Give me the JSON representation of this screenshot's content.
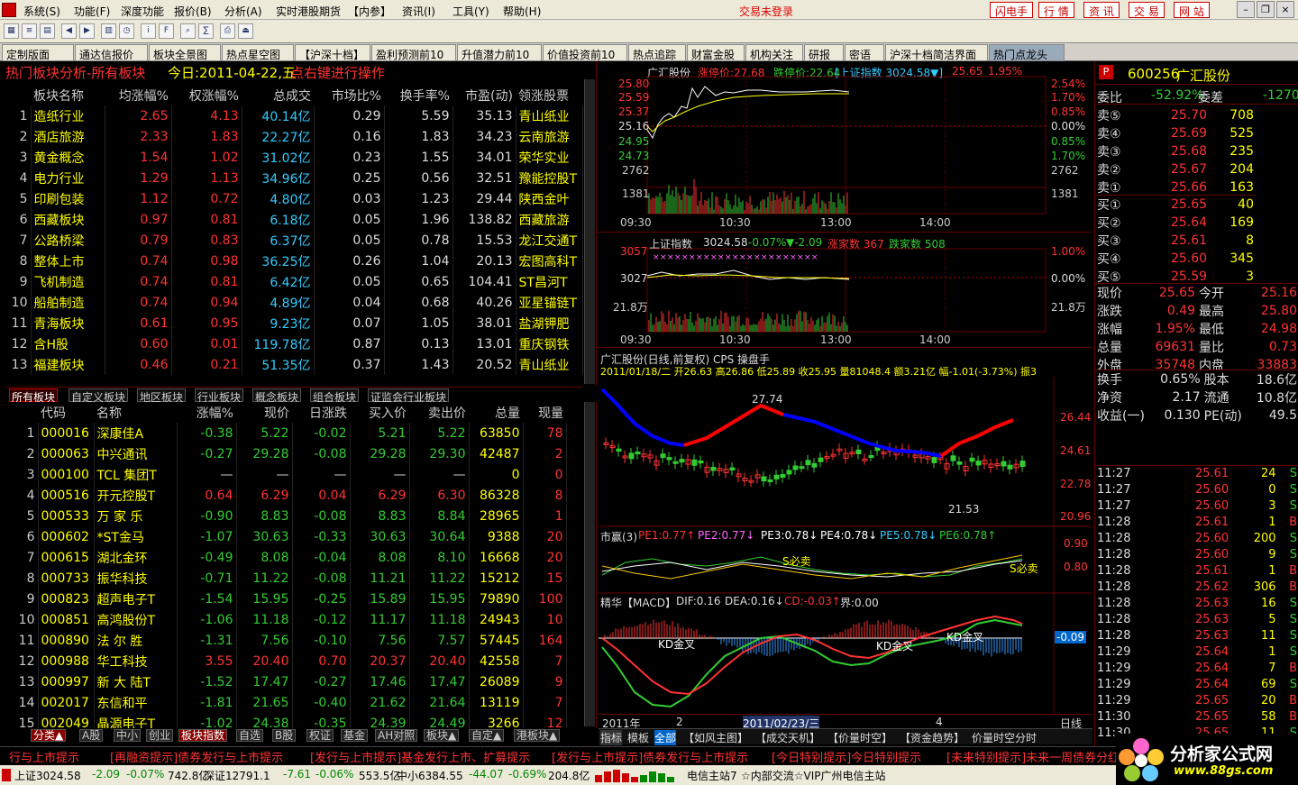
{
  "menu": [
    "系统(S)",
    "功能(F)",
    "深度功能",
    "报价(B)",
    "分析(A)",
    "实时港股期货",
    "【内参】",
    "资讯(I)",
    "工具(Y)",
    "帮助(H)"
  ],
  "menu_center": "交易未登录",
  "menu_right": [
    "闪电手",
    "行 情",
    "资 讯",
    "交 易",
    "网 站"
  ],
  "tabs": [
    "定制版面",
    "通达信报价",
    "板块全景图",
    "热点星空图",
    "【沪深十档】",
    "盈利预测前10",
    "升值潜力前10",
    "价值投资前10",
    "热点追踪",
    "财富金股",
    "机构关注",
    "研报",
    "密语",
    "沪深十档简洁界面",
    "热门点龙头"
  ],
  "sector": {
    "title": "热门板块分析-所有板块",
    "date": "今日:2011-04-22,五",
    "hint": "点右键进行操作",
    "headers": [
      "板块名称",
      "均涨幅%",
      "权涨幅%",
      "总成交",
      "市场比%",
      "换手率%",
      "市盈(动)",
      "领涨股票"
    ],
    "rows": [
      [
        "1",
        "造纸行业",
        "2.65",
        "4.13",
        "40.14亿",
        "0.29",
        "5.59",
        "35.13",
        "青山纸业"
      ],
      [
        "2",
        "酒店旅游",
        "2.33",
        "1.83",
        "22.27亿",
        "0.16",
        "1.83",
        "34.23",
        "云南旅游"
      ],
      [
        "3",
        "黄金概念",
        "1.54",
        "1.02",
        "31.02亿",
        "0.23",
        "1.55",
        "34.01",
        "荣华实业"
      ],
      [
        "4",
        "电力行业",
        "1.29",
        "1.13",
        "34.96亿",
        "0.25",
        "0.56",
        "32.51",
        "豫能控股T"
      ],
      [
        "5",
        "印刷包装",
        "1.12",
        "0.72",
        "4.80亿",
        "0.03",
        "1.23",
        "29.44",
        "陕西金叶"
      ],
      [
        "6",
        "西藏板块",
        "0.97",
        "0.81",
        "6.18亿",
        "0.05",
        "1.96",
        "138.82",
        "西藏旅游"
      ],
      [
        "7",
        "公路桥梁",
        "0.79",
        "0.83",
        "6.37亿",
        "0.05",
        "0.78",
        "15.53",
        "龙江交通T"
      ],
      [
        "8",
        "整体上市",
        "0.74",
        "0.98",
        "36.25亿",
        "0.26",
        "1.04",
        "20.13",
        "宏图高科T"
      ],
      [
        "9",
        "飞机制造",
        "0.74",
        "0.81",
        "6.42亿",
        "0.05",
        "0.65",
        "104.41",
        "ST昌河T"
      ],
      [
        "10",
        "船舶制造",
        "0.74",
        "0.94",
        "4.89亿",
        "0.04",
        "0.68",
        "40.26",
        "亚星锚链T"
      ],
      [
        "11",
        "青海板块",
        "0.61",
        "0.95",
        "9.23亿",
        "0.07",
        "1.05",
        "38.01",
        "盐湖钾肥"
      ],
      [
        "12",
        "含H股",
        "0.60",
        "0.01",
        "119.78亿",
        "0.87",
        "0.13",
        "13.01",
        "重庆钢铁"
      ],
      [
        "13",
        "福建板块",
        "0.46",
        "0.21",
        "51.35亿",
        "0.37",
        "1.43",
        "20.52",
        "青山纸业"
      ]
    ]
  },
  "subtabs": [
    "所有板块",
    "自定义板块",
    "地区板块",
    "行业板块",
    "概念板块",
    "组合板块",
    "证监会行业板块"
  ],
  "stocks": {
    "headers": [
      "代码",
      "名称",
      "涨幅%",
      "现价",
      "日涨跌",
      "买入价",
      "卖出价",
      "总量",
      "现量"
    ],
    "rows": [
      [
        "1",
        "000016",
        "深康佳A",
        "-0.38",
        "5.22",
        "-0.02",
        "5.21",
        "5.22",
        "63850",
        "78"
      ],
      [
        "2",
        "000063",
        "中兴通讯",
        "-0.27",
        "29.28",
        "-0.08",
        "29.28",
        "29.30",
        "42487",
        "2"
      ],
      [
        "3",
        "000100",
        "TCL 集团T",
        "—",
        "—",
        "—",
        "—",
        "—",
        "0",
        "0"
      ],
      [
        "4",
        "000516",
        "开元控股T",
        "0.64",
        "6.29",
        "0.04",
        "6.29",
        "6.30",
        "86328",
        "8"
      ],
      [
        "5",
        "000533",
        "万 家 乐",
        "-0.90",
        "8.83",
        "-0.08",
        "8.83",
        "8.84",
        "28965",
        "1"
      ],
      [
        "6",
        "000602",
        "*ST金马",
        "-1.07",
        "30.63",
        "-0.33",
        "30.63",
        "30.64",
        "9388",
        "20"
      ],
      [
        "7",
        "000615",
        "湖北金环",
        "-0.49",
        "8.08",
        "-0.04",
        "8.08",
        "8.10",
        "16668",
        "20"
      ],
      [
        "8",
        "000733",
        "振华科技",
        "-0.71",
        "11.22",
        "-0.08",
        "11.21",
        "11.22",
        "15212",
        "15"
      ],
      [
        "9",
        "000823",
        "超声电子T",
        "-1.54",
        "15.95",
        "-0.25",
        "15.89",
        "15.95",
        "79890",
        "100"
      ],
      [
        "10",
        "000851",
        "高鸿股份T",
        "-1.06",
        "11.18",
        "-0.12",
        "11.17",
        "11.18",
        "24943",
        "10"
      ],
      [
        "11",
        "000890",
        "法 尔 胜",
        "-1.31",
        "7.56",
        "-0.10",
        "7.56",
        "7.57",
        "57445",
        "164"
      ],
      [
        "12",
        "000988",
        "华工科技",
        "3.55",
        "20.40",
        "0.70",
        "20.37",
        "20.40",
        "42558",
        "7"
      ],
      [
        "13",
        "000997",
        "新 大 陆T",
        "-1.52",
        "17.47",
        "-0.27",
        "17.46",
        "17.47",
        "26089",
        "9"
      ],
      [
        "14",
        "002017",
        "东信和平",
        "-1.81",
        "21.65",
        "-0.40",
        "21.62",
        "21.64",
        "13119",
        "7"
      ],
      [
        "15",
        "002049",
        "晶源电子T",
        "-1.02",
        "24.38",
        "-0.35",
        "24.39",
        "24.49",
        "3266",
        "12"
      ]
    ]
  },
  "bottom_tabs": [
    "分类▲",
    "A股",
    "中小",
    "创业",
    "板块指数",
    "自选",
    "B股",
    "权证",
    "基金",
    "AH对照",
    "板块▲",
    "自定▲",
    "港板块▲"
  ],
  "intraday1": {
    "name": "广汇股份",
    "zt": "涨停价:27.68",
    "dt": "跌停价:22.64",
    "idx": "[上证指数 3024.58▼]",
    "price": "25.65",
    "pct": "1.95%",
    "left_ticks": [
      "25.80",
      "25.59",
      "25.37",
      "25.16",
      "24.95",
      "24.73",
      "2762",
      "1381"
    ],
    "right_ticks": [
      "2.54%",
      "1.70%",
      "0.85%",
      "0.00%",
      "0.85%",
      "1.70%",
      "2762",
      "1381"
    ],
    "times": [
      "09:30",
      "10:30",
      "13:00",
      "14:00"
    ]
  },
  "intraday2": {
    "name": "上证指数",
    "val": "3024.58",
    "pct": "-0.07%",
    "chg": "▼-2.09",
    "up": "涨家数 367",
    "down": "跌家数 508",
    "left_ticks": [
      "3057",
      "3027",
      "21.8万"
    ],
    "right_ticks": [
      "1.00%",
      "0.00%",
      "21.8万"
    ],
    "times": [
      "09:30",
      "10:30",
      "13:00",
      "14:00"
    ]
  },
  "kline": {
    "title": "广汇股份(日线,前复权) CPS 操盘手",
    "info": "2011/01/18/二 开26.63 高26.86 低25.89 收25.95 量81048.4 额3.21亿 幅-1.01(-3.73%) 振3",
    "ticks": [
      "26.44",
      "24.61",
      "22.78",
      "20.96"
    ],
    "high_label": "27.74",
    "low_label": "21.53",
    "ind1": [
      "市赢(3)",
      "PE1:0.77↑",
      "PE2:0.77↓",
      "PE3:0.78↓",
      "PE4:0.78↓",
      "PE5:0.78↓",
      "PE6:0.78↑"
    ],
    "ind1_ticks": [
      "0.90",
      "0.80"
    ],
    "ind1_labels": [
      "S必卖",
      "S必卖"
    ],
    "ind2": [
      "精华【MACD】",
      "DIF:0.16",
      "DEA:0.16↓",
      "CD:-0.03↑",
      "界:0.00"
    ],
    "ind2_val": "-0.09",
    "ind2_labels": [
      "KD金叉",
      "KD金叉",
      "KD金叉"
    ],
    "xlabels": [
      "2011年",
      "2",
      "2011/02/23/三",
      "4",
      "日线"
    ],
    "bottom_tabs": [
      "指标",
      "模板",
      "全部",
      "【如风主图】",
      "【成交天机】",
      "【价量时空】",
      "【资金趋势】",
      "价量时空分时"
    ]
  },
  "quote": {
    "code": "600256",
    "name": "广汇股份",
    "weibi": "委比",
    "wb": "-52.92%",
    "weicha": "委差",
    "wc": "-1270",
    "asks": [
      [
        "卖⑤",
        "25.70",
        "708"
      ],
      [
        "卖④",
        "25.69",
        "525"
      ],
      [
        "卖③",
        "25.68",
        "235"
      ],
      [
        "卖②",
        "25.67",
        "204"
      ],
      [
        "卖①",
        "25.66",
        "163"
      ]
    ],
    "bids": [
      [
        "买①",
        "25.65",
        "40"
      ],
      [
        "买②",
        "25.64",
        "169"
      ],
      [
        "买③",
        "25.61",
        "8"
      ],
      [
        "买④",
        "25.60",
        "345"
      ],
      [
        "买⑤",
        "25.59",
        "3"
      ]
    ],
    "stats": [
      [
        "现价",
        "25.65",
        "今开",
        "25.16"
      ],
      [
        "涨跌",
        "0.49",
        "最高",
        "25.80"
      ],
      [
        "涨幅",
        "1.95%",
        "最低",
        "24.98"
      ],
      [
        "总量",
        "69631",
        "量比",
        "0.73"
      ],
      [
        "外盘",
        "35748",
        "内盘",
        "33883"
      ]
    ],
    "stats2": [
      [
        "换手",
        "0.65%",
        "股本",
        "18.6亿"
      ],
      [
        "净资",
        "2.17",
        "流通",
        "10.8亿"
      ],
      [
        "收益(一)",
        "0.130",
        "PE(动)",
        "49.5"
      ]
    ],
    "ticks": [
      [
        "11:27",
        "25.61",
        "24",
        "S"
      ],
      [
        "11:27",
        "25.60",
        "0",
        "S"
      ],
      [
        "11:27",
        "25.60",
        "3",
        "S"
      ],
      [
        "11:28",
        "25.61",
        "1",
        "B"
      ],
      [
        "11:28",
        "25.60",
        "200",
        "S"
      ],
      [
        "11:28",
        "25.60",
        "9",
        "S"
      ],
      [
        "11:28",
        "25.61",
        "1",
        "B"
      ],
      [
        "11:28",
        "25.62",
        "306",
        "B"
      ],
      [
        "11:28",
        "25.63",
        "16",
        "S"
      ],
      [
        "11:28",
        "25.63",
        "5",
        "S"
      ],
      [
        "11:28",
        "25.63",
        "11",
        "S"
      ],
      [
        "11:29",
        "25.64",
        "1",
        "S"
      ],
      [
        "11:29",
        "25.64",
        "7",
        "B"
      ],
      [
        "11:29",
        "25.64",
        "69",
        "S"
      ],
      [
        "11:29",
        "25.65",
        "20",
        "B"
      ],
      [
        "11:30",
        "25.65",
        "58",
        "B"
      ],
      [
        "11:30",
        "25.65",
        "11",
        "S"
      ]
    ]
  },
  "ticker": [
    "行与上市提示",
    "[再融资提示]债券发行与上市提示",
    "[发行与上市提示]基金发行上市、扩募提示",
    "[发行与上市提示]债券发行与上市提示",
    "[今日特别提示]今日特别提示",
    "[未来特别提示]未来一周债券分红提"
  ],
  "status": {
    "sh": "上证3024.58",
    "sh_chg": "-2.09",
    "sh_pct": "-0.07%",
    "sh_amt": "742.8亿",
    "sz": "深证12791.1",
    "sz_chg": "-7.61",
    "sz_pct": "-0.06%",
    "sz_amt": "553.5亿",
    "zx": "中小6384.55",
    "zx_chg": "-44.07",
    "zx_pct": "-0.69%",
    "zx_amt": "204.8亿",
    "server": "电信主站7",
    "msg": "☆内部交流☆VIP广州电信主站"
  },
  "logo_text": "分析家公式网",
  "logo_url": "www.88gs.com"
}
